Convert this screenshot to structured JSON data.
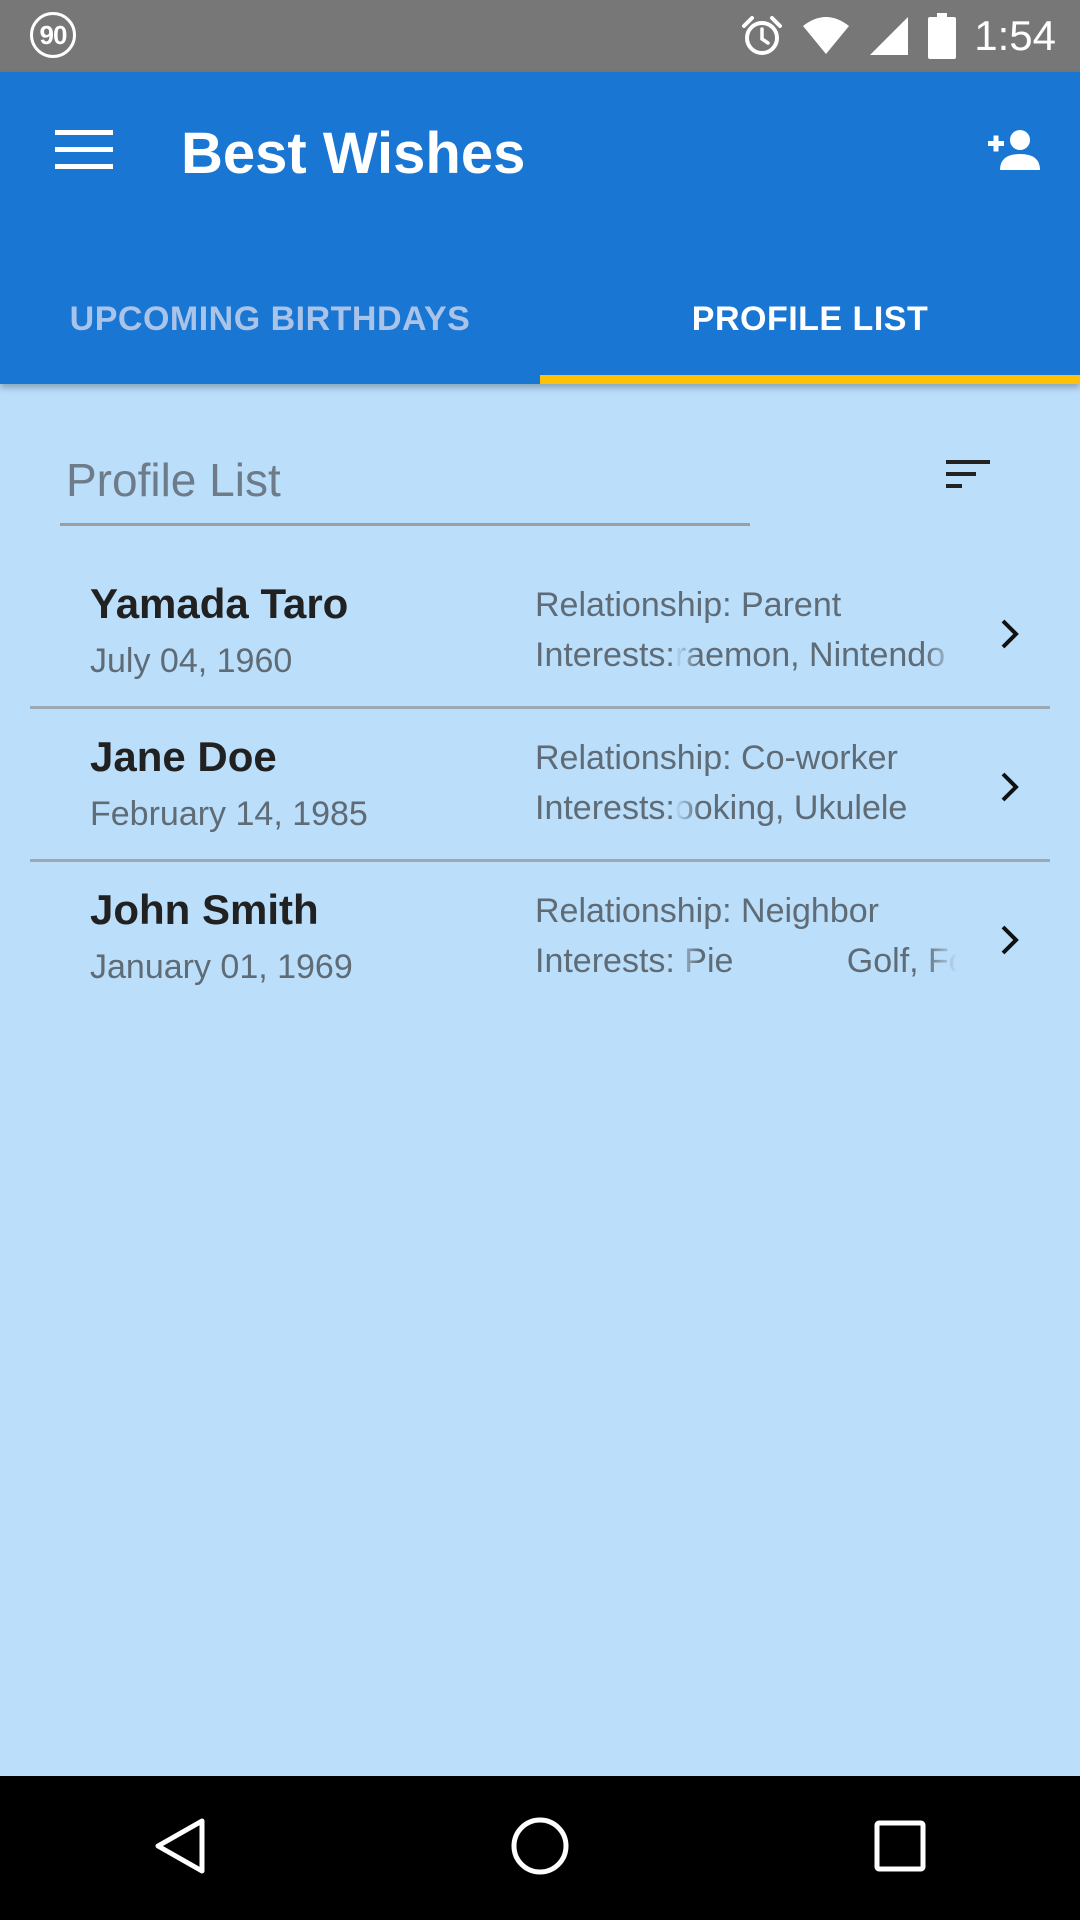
{
  "status_bar": {
    "badge": "90",
    "time": "1:54",
    "icons": [
      "alarm-icon",
      "wifi-icon",
      "signal-icon",
      "battery-icon"
    ]
  },
  "app_bar": {
    "title": "Best Wishes",
    "menu_icon": "hamburger-menu-icon",
    "add_icon": "person-add-icon"
  },
  "tabs": [
    {
      "label": "UPCOMING BIRTHDAYS",
      "active": false
    },
    {
      "label": "PROFILE LIST",
      "active": true
    }
  ],
  "filter": {
    "placeholder": "Profile List",
    "sort_icon": "sort-icon"
  },
  "profiles": [
    {
      "name": "Yamada Taro",
      "birthday": "July 04, 1960",
      "relationship": "Relationship: Parent",
      "interests_label": "Interests:",
      "interests_value": "raemon, Nintendo"
    },
    {
      "name": "Jane Doe",
      "birthday": "February 14, 1985",
      "relationship": "Relationship: Co-worker",
      "interests_label": "Interests:",
      "interests_value": "ooking, Ukulele"
    },
    {
      "name": "John Smith",
      "birthday": "January 01, 1969",
      "relationship": "Relationship: Neighbor",
      "interests_label": "Interests:",
      "interests_value": " Pie            Golf, Fo"
    }
  ],
  "colors": {
    "primary": "#1976D2",
    "accent": "#FFC107",
    "background": "#BBDEFB",
    "status_bar": "#777777"
  }
}
